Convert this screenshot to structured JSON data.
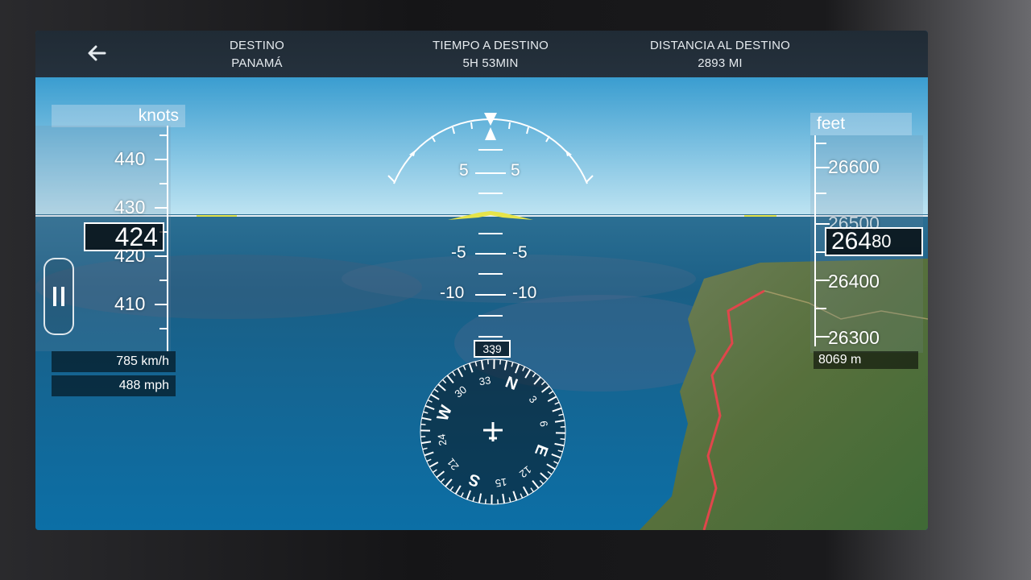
{
  "topbar": {
    "destination_label": "DESTINO",
    "destination_value": "PANAMÁ",
    "time_label": "TIEMPO A DESTINO",
    "time_value": "5H 53MIN",
    "distance_label": "DISTANCIA AL DESTINO",
    "distance_value": "2893 MI"
  },
  "speed": {
    "unit": "knots",
    "ticks": [
      "440",
      "430",
      "420",
      "410"
    ],
    "current": "424",
    "kmh": "785 km/h",
    "mph": "488 mph"
  },
  "altitude": {
    "unit": "feet",
    "ticks": [
      "26600",
      "26500",
      "26400",
      "26300"
    ],
    "current": "264",
    "current_roll": "80",
    "meters": "8069 m"
  },
  "pitch": {
    "up5_left": "5",
    "up5_right": "5",
    "down5_left": "-5",
    "down5_right": "-5",
    "down10_left": "-10",
    "down10_right": "-10"
  },
  "heading": {
    "value": "339",
    "labels": [
      "N",
      "3",
      "6",
      "E",
      "12",
      "15",
      "S",
      "21",
      "24",
      "W",
      "30",
      "33"
    ]
  },
  "colors": {
    "sky_top": "#3a9dd0",
    "sea": "#0b5d8c",
    "route": "#e0464b",
    "horizon_marker": "#e6e44a"
  }
}
